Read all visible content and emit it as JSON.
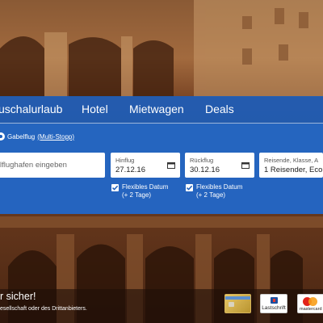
{
  "nav": {
    "tabs": [
      {
        "label": "uschalurlaub"
      },
      {
        "label": "Hotel"
      },
      {
        "label": "Mietwagen"
      },
      {
        "label": "Deals"
      }
    ]
  },
  "trip_type": {
    "label": "Gabelflug",
    "link": "(Multi-Stopp)"
  },
  "search": {
    "origin_placeholder": "lflughafen eingeben",
    "outbound": {
      "label": "Hinflug",
      "value": "27.12.16"
    },
    "return": {
      "label": "Rückflug",
      "value": "30.12.16"
    },
    "travellers": {
      "label": "Reisende, Klasse, A",
      "value": "1 Reisender, Eco"
    }
  },
  "flexible": [
    {
      "line1": "Flexibles Datum",
      "line2": "(+ 2 Tage)"
    },
    {
      "line1": "Flexibles Datum",
      "line2": "(+ 2 Tage)"
    }
  ],
  "footer": {
    "title": "r sicher!",
    "subtitle": "esellschaft oder des Drittanbieters.",
    "payment": {
      "lastschrift": "Lastschrift",
      "mastercard": "mastercard"
    }
  },
  "colors": {
    "band": "#1c5dba",
    "accent": "#ffffff"
  }
}
